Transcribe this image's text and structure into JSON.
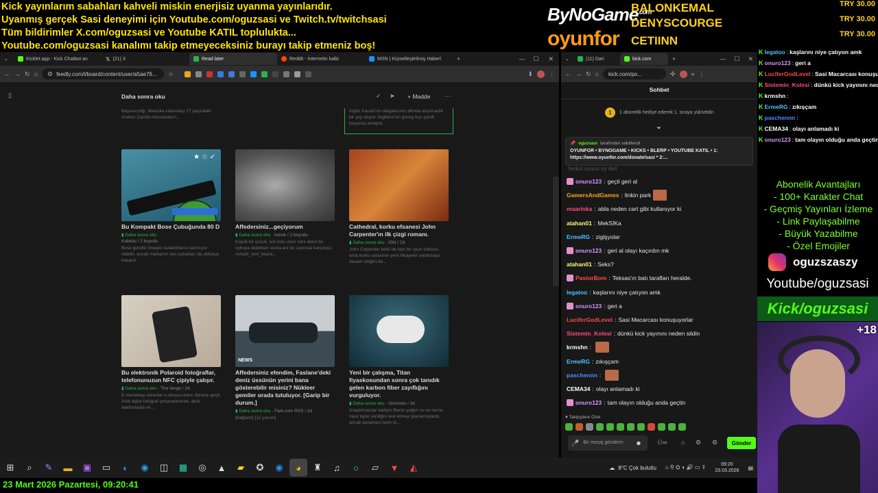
{
  "banner": {
    "lines": [
      "Kick yayınlarım sabahları kahveli miskin enerjisiz uyanma yayınlarıdır.",
      "Uyanmış gerçek Sasi deneyimi için Youtube.com/oguzsasi ve Twitch.tv/twitchsasi",
      "Tüm bildirimler X.com/oguzsasi ve Youtube KATIL toplulukta...",
      "Youtube.com/oguzsasi kanalımı takip etmeyeceksiniz burayı takip etmeniz boş!"
    ]
  },
  "brand": {
    "bynogame": "ByNoGame",
    "bynogame_sup": ".com",
    "oyunfor": "oyunfor",
    "sponsors": [
      "BALONKEMAL",
      "DENYSCOURGE",
      "CETIINN"
    ],
    "donations": [
      "TRY 30.00",
      "TRY 30.00",
      "TRY 30.00"
    ]
  },
  "browser1": {
    "tabs": [
      {
        "label": "Kicklet.app - Kick Chatbot an",
        "color": "#53fc18"
      },
      {
        "label": "(21) X",
        "color": "#ffffff"
      },
      {
        "label": "Read later",
        "color": "#2bb24c",
        "active": true
      },
      {
        "label": "Reddit - İnternetin kalbi",
        "color": "#ff4500"
      },
      {
        "label": "MSN | Kişiselleştirilmiş Haberl",
        "color": "#1e90ff"
      }
    ],
    "url": "feedly.com/i/board/content/user/a5ae76...",
    "board_title": "Daha sonra oku",
    "madde": "Madde",
    "top_snippets": [
      "Başsavcılığı, Meksika vatandaşı 27 yaşındaki Andres Carrillo-Hernandez'i...",
      "İngiliz Kanalı'nın dalgalarının altında alışılmadık bir şey oluyor. İngiltere'nin güney kıyı şeridi boyunca ahtapot..."
    ],
    "cards": [
      {
        "title": "Bu Kompakt Bose Çubuğunda 80 D",
        "tag": "Daha sonra oku",
        "source": "Kablolu / 2 boyutlu",
        "desc": "Bose gürültü önleyici kulaklıklarını tanınıyor olabilir, ancak markanın ses çubukları da oldukça başarılı."
      },
      {
        "title": "Affedersiniz...geçiyorum",
        "tag": "Daha sonra oku",
        "source": "komik / 2 boyutlu",
        "desc": "Küçük bir çocuk, sırt üstü uzun süre derin bir uykuya daldıktan sonra ani bir uyanışla karşılaştı. /u/baid_and_beard..."
      },
      {
        "title": "Cathedral, korku efsanesi John Carpenter'ın ilk çizgi romanı.",
        "tag": "Daha sonra oku",
        "source": "IGN / 2d",
        "desc": "John Carpenter belki de tam bir oyun tutkunu, ama korku ustasının yeni hikayeler anlatmaya devam ettiğini de..."
      },
      {
        "title": "Bu elektronik Polaroid fotoğraflar, telefonunuzun NFC çipiyle çalışır.",
        "tag": "Daha sonra oku",
        "source": "The Verge / 2d",
        "desc": "E-mürekkep ekranlar e-okuyucuların ötesine geçti. Artık dijital fotoğraf çerçevelerinde, akıllı telefonlarda ve..."
      },
      {
        "title": "Affedersiniz efendim, Faslane'deki deniz üssünün yerini bana gösterebilir misiniz? Nükleer gemiler orada tutuluyor. [Garip bir durum.]",
        "tag": "Daha sonra oku",
        "source": "Fark.com RSS / 2d",
        "desc": "[bağlantı] [12 yorum]",
        "news_label": "NEWS"
      },
      {
        "title": "Yeni bir çalışma, Titan fiyaskosundan sonra çok tanıdık gelen karbon fiber zayıflığını vurguluyor.",
        "tag": "Daha sonra oku",
        "source": "Gizmodo / 2d",
        "desc": "Araştırmacılar karbon fiberin yoğun ısı ve neme nasıl tepki verdiğini test etmeyi planlamışlardı, ancak tamamen farklı bi..."
      }
    ]
  },
  "browser2": {
    "tabs": [
      {
        "label": "(11) Dari",
        "color": "#2bb24c"
      },
      {
        "label": "kick.com",
        "color": "#53fc18",
        "active": true
      }
    ],
    "url": "kick.com/po...",
    "chat_title": "Sohbet",
    "gift_notice": "1 abonelik hediye ederek 1. sıraya yükseldin",
    "pinned_by": "oguzsasi",
    "pinned_suffix": "tarafından sabitlendi",
    "pinned_text": "OYUNFOR • BYNOGAME • KICKS • BLERP • YOUTUBE KATIL • 1: https://www.oyunfor.com/donate/sasi * 2:...",
    "cut_line": "herkul oyunu oy dell",
    "messages": [
      {
        "user": "onuro123",
        "text": "geçti geri al",
        "color": "#d896ff",
        "badge": true
      },
      {
        "user": "GamersAndGames",
        "text": "linkin park",
        "color": "#f5a623",
        "emote": true
      },
      {
        "user": "maarinka",
        "text": "abla neden cart gibi kullanıyor ki",
        "color": "#ff4b7d"
      },
      {
        "user": "atahan01",
        "text": "MekSİKa",
        "color": "#fffb7a"
      },
      {
        "user": "ErmeRG",
        "text": "ziglşyolar",
        "color": "#4fc3ff"
      },
      {
        "user": "onuro123",
        "text": "geri al olayı kaçırdın mk",
        "color": "#d896ff",
        "badge": true
      },
      {
        "user": "atahan01",
        "text": "Seks?",
        "color": "#fffb7a"
      },
      {
        "user": "PastorBom",
        "text": "Teksas'ın batı tarafları heralde.",
        "color": "#ff4848",
        "badge": true
      },
      {
        "user": "legatoo",
        "text": "kaşlarını niye çatıyon amk",
        "color": "#4fc3ff"
      },
      {
        "user": "onuro123",
        "text": "geri a",
        "color": "#d896ff",
        "badge": true
      },
      {
        "user": "LuciferGodLevel",
        "text": "Sasi Macarcası konuşuyorlar",
        "color": "#ff4848"
      },
      {
        "user": "Sistemin_Kolesi",
        "text": "dünkü kick yayınını neden sildin",
        "color": "#ff4b7d"
      },
      {
        "user": "krmshn",
        "text": "",
        "color": "#ffffff",
        "emote": true
      },
      {
        "user": "ErmeRG",
        "text": "zıkışçam",
        "color": "#4fc3ff"
      },
      {
        "user": "paschennn",
        "text": "",
        "color": "#4f8bff",
        "emote": true
      },
      {
        "user": "CEMA34",
        "text": "olayı anlamadı ki",
        "color": "#ffffff"
      },
      {
        "user": "onuro123",
        "text": "tam olayın olduğu anda geçtin",
        "color": "#d896ff",
        "badge": true
      }
    ],
    "followers_only": "Takipçilere Özel",
    "input_placeholder": "Bir mesaj gönderin",
    "send_label": "Gönder"
  },
  "right_chat": [
    {
      "user": "legatoo",
      "text": "kaşlarını niye çatıyon amk"
    },
    {
      "user": "onuro123",
      "text": "geri a"
    },
    {
      "user": "LuciferGodLevel",
      "text": "Sasi Macarcası konuşuyorlar"
    },
    {
      "user": "Sistemin_Kolesi",
      "text": "dünkü kick yayınını neden sildin"
    },
    {
      "user": "krmshn",
      "text": ""
    },
    {
      "user": "ErmeRG",
      "text": "zıkışçam"
    },
    {
      "user": "paschennn",
      "text": ""
    },
    {
      "user": "CEMA34",
      "text": "olayı anlamadı ki"
    },
    {
      "user": "onuro123",
      "text": "tam olayın olduğu anda geçtin"
    }
  ],
  "perks": {
    "title": "Abonelik Avantajları",
    "items": [
      "- 100+ Karakter Chat",
      "- Geçmiş Yayınları İzleme",
      "- Link Paylaşabilme",
      "- Büyük Yazabilme",
      "- Özel Emojiler"
    ]
  },
  "instagram": "oguzszaszy",
  "youtube": "Youtube/oguzsasi",
  "kick_handle": "Kick/oguzsasi",
  "cam_badge": "+18",
  "taskbar": {
    "weather": "8°C  Çok bulutlu",
    "time": "09:20",
    "date": "23.03.2026"
  },
  "footer_date": "23 Mart 2026 Pazartesi, 09:20:41"
}
